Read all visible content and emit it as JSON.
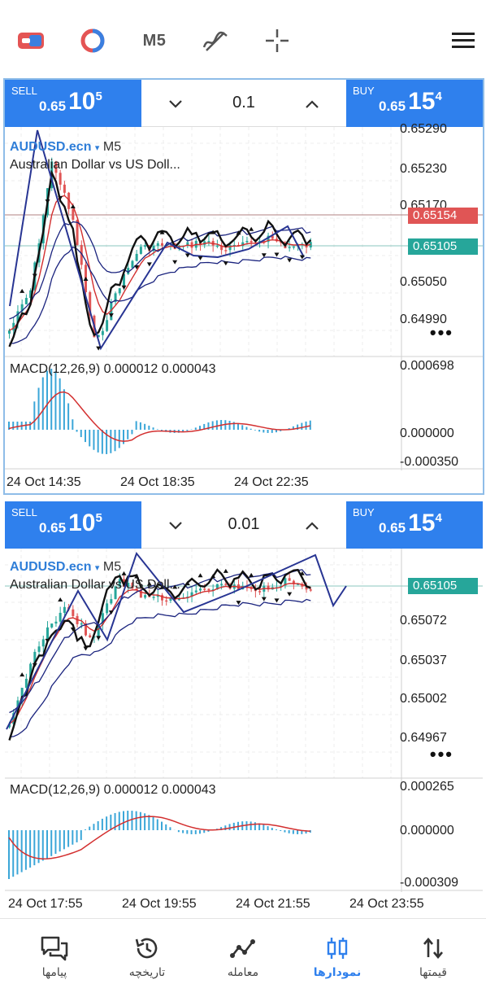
{
  "toolbar": {
    "items": [
      {
        "name": "one-click-trading-icon"
      },
      {
        "name": "indicators-icon"
      },
      {
        "name": "timeframe",
        "label": "M5"
      },
      {
        "name": "objects-icon"
      },
      {
        "name": "crosshair-icon"
      },
      {
        "name": "menu-icon"
      }
    ]
  },
  "colors": {
    "accent": "#2f80ed",
    "ask_tag": "#e05555",
    "bid_tag": "#26a69a",
    "macd_hist": "#3ba6d8",
    "signal": "#d32f2f"
  },
  "chart1": {
    "sell": {
      "tag": "SELL",
      "small": "0.65",
      "big": "10",
      "sup": "5"
    },
    "buy": {
      "tag": "BUY",
      "small": "0.65",
      "big": "15",
      "sup": "4"
    },
    "lot": "0.1",
    "symbol": "AUDUSD.ecn",
    "symbol_arrow": "▾",
    "timeframe": "M5",
    "description": "Australian Dollar vs US Doll...",
    "price_axis": [
      "0.65290",
      "0.65230",
      "0.65170",
      "0.65050",
      "0.64990"
    ],
    "ask_tag": "0.65154",
    "bid_tag": "0.65105",
    "more": "•••",
    "macd_label": "MACD(12,26,9) 0.000012 0.000043",
    "macd_axis": [
      "0.000698",
      "0.000000",
      "-0.000350"
    ],
    "time_axis": [
      "24 Oct 14:35",
      "24 Oct 18:35",
      "24 Oct 22:35"
    ]
  },
  "chart2": {
    "sell": {
      "tag": "SELL",
      "small": "0.65",
      "big": "10",
      "sup": "5"
    },
    "buy": {
      "tag": "BUY",
      "small": "0.65",
      "big": "15",
      "sup": "4"
    },
    "lot": "0.01",
    "symbol": "AUDUSD.ecn",
    "symbol_arrow": "▾",
    "timeframe": "M5",
    "description": "Australian Dollar vs US Doll...",
    "price_axis": [
      "0.65072",
      "0.65037",
      "0.65002",
      "0.64967"
    ],
    "bid_tag": "0.65105",
    "more": "•••",
    "macd_label": "MACD(12,26,9) 0.000012 0.000043",
    "macd_axis": [
      "0.000265",
      "0.000000",
      "-0.000309"
    ],
    "time_axis": [
      "24 Oct 17:55",
      "24 Oct 19:55",
      "24 Oct 21:55",
      "24 Oct 23:55"
    ]
  },
  "bottom_nav": [
    {
      "name": "nav-quotes",
      "icon": "quotes-icon",
      "label": "قیمتها",
      "active": false
    },
    {
      "name": "nav-charts",
      "icon": "charts-icon",
      "label": "نمودارها",
      "active": true
    },
    {
      "name": "nav-trade",
      "icon": "trade-icon",
      "label": "معامله",
      "active": false
    },
    {
      "name": "nav-history",
      "icon": "history-icon",
      "label": "تاریخچه",
      "active": false
    },
    {
      "name": "nav-messages",
      "icon": "messages-icon",
      "label": "پیامها",
      "active": false
    }
  ]
}
